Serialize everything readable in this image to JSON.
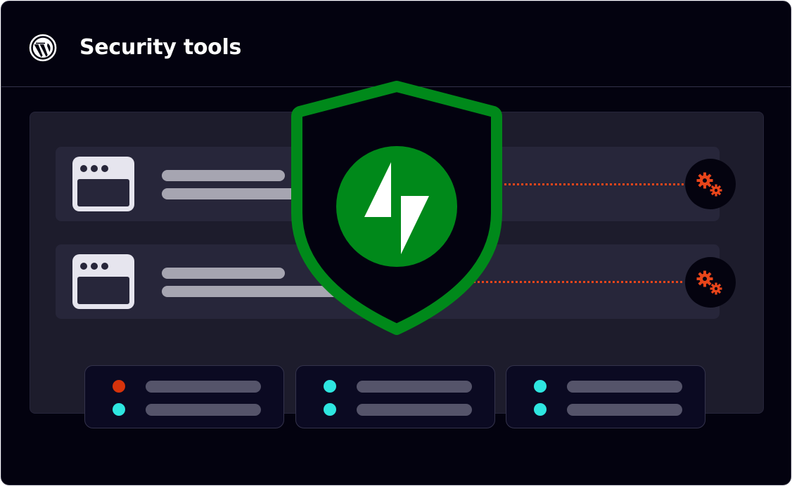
{
  "header": {
    "title": "Security tools",
    "logo_icon": "wordpress-logo-icon"
  },
  "colors": {
    "background": "#03020f",
    "panel": "#1d1c2c",
    "row": "#27263a",
    "shield_green": "#00891a",
    "warning_orange": "#e8451a",
    "status_cyan": "#2ee6e0",
    "status_red": "#d7330b",
    "text_white": "#ffffff"
  },
  "sites": [
    {
      "icon": "browser-window-icon",
      "status_icon": "gears-icon"
    },
    {
      "icon": "browser-window-icon",
      "status_icon": "gears-icon"
    }
  ],
  "center_badge": {
    "icon": "jetpack-shield-icon"
  },
  "cards": [
    {
      "dots": [
        "red",
        "cyan"
      ]
    },
    {
      "dots": [
        "cyan",
        "cyan"
      ]
    },
    {
      "dots": [
        "cyan",
        "cyan"
      ]
    }
  ]
}
